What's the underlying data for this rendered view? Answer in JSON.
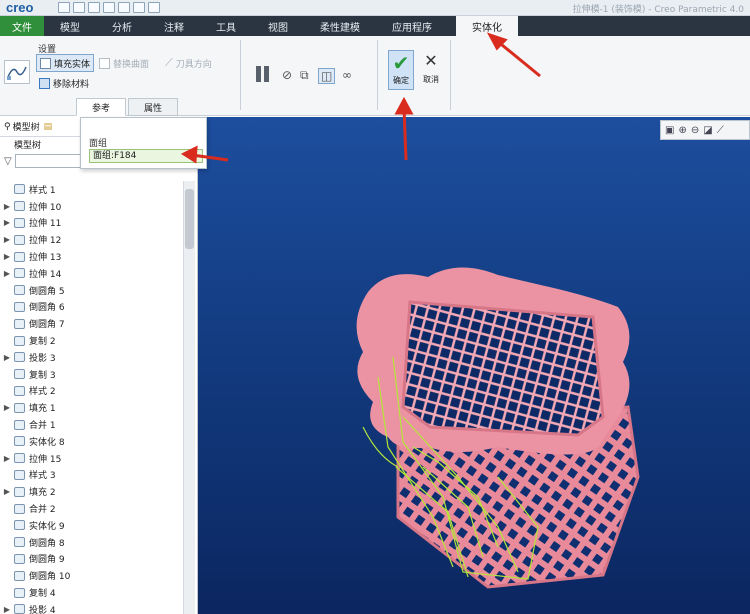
{
  "app": {
    "logo": "creo",
    "window_title": "拉伸模-1 (装饰模) - Creo Parametric 4.0"
  },
  "ribbon_tabs": [
    {
      "label": "文件"
    },
    {
      "label": "模型"
    },
    {
      "label": "分析"
    },
    {
      "label": "注释"
    },
    {
      "label": "工具"
    },
    {
      "label": "视图"
    },
    {
      "label": "柔性建模"
    },
    {
      "label": "应用程序"
    },
    {
      "label": "实体化"
    }
  ],
  "ribbon": {
    "settings_label": "设置",
    "fill_solid": "填充实体",
    "replace_surface": "替换曲面",
    "knife_direction": "刀具方向",
    "remove_material": "移除材料",
    "sub_tabs": [
      "参考",
      "属性"
    ],
    "ok_label": "确定",
    "cancel_label": "取消"
  },
  "ref_popup": {
    "header": "面组",
    "item": "面组:F184"
  },
  "left_panel": {
    "tab_model_tree": "模型树",
    "tree_header": "模型树",
    "items": [
      {
        "label": "样式 1",
        "expandable": false
      },
      {
        "label": "拉伸 10",
        "expandable": true
      },
      {
        "label": "拉伸 11",
        "expandable": true
      },
      {
        "label": "拉伸 12",
        "expandable": true
      },
      {
        "label": "拉伸 13",
        "expandable": true
      },
      {
        "label": "拉伸 14",
        "expandable": true
      },
      {
        "label": "倒圆角 5",
        "expandable": false
      },
      {
        "label": "倒圆角 6",
        "expandable": false
      },
      {
        "label": "倒圆角 7",
        "expandable": false
      },
      {
        "label": "复制 2",
        "expandable": false
      },
      {
        "label": "投影 3",
        "expandable": true
      },
      {
        "label": "复制 3",
        "expandable": false
      },
      {
        "label": "样式 2",
        "expandable": false
      },
      {
        "label": "填充 1",
        "expandable": true
      },
      {
        "label": "合并 1",
        "expandable": false
      },
      {
        "label": "实体化 8",
        "expandable": false
      },
      {
        "label": "拉伸 15",
        "expandable": true
      },
      {
        "label": "样式 3",
        "expandable": false
      },
      {
        "label": "填充 2",
        "expandable": true
      },
      {
        "label": "合并 2",
        "expandable": false
      },
      {
        "label": "实体化 9",
        "expandable": false
      },
      {
        "label": "倒圆角 8",
        "expandable": false
      },
      {
        "label": "倒圆角 9",
        "expandable": false
      },
      {
        "label": "倒圆角 10",
        "expandable": false
      },
      {
        "label": "复制 4",
        "expandable": false
      },
      {
        "label": "投影 4",
        "expandable": true
      }
    ]
  },
  "colors": {
    "file_tab": "#2f8f3a",
    "tab_bar": "#2b3541",
    "viewport_top": "#1d4e9e",
    "model_pink": "#e98a9a",
    "wire_green": "#b5e63a",
    "annotation": "#d92b1e"
  }
}
